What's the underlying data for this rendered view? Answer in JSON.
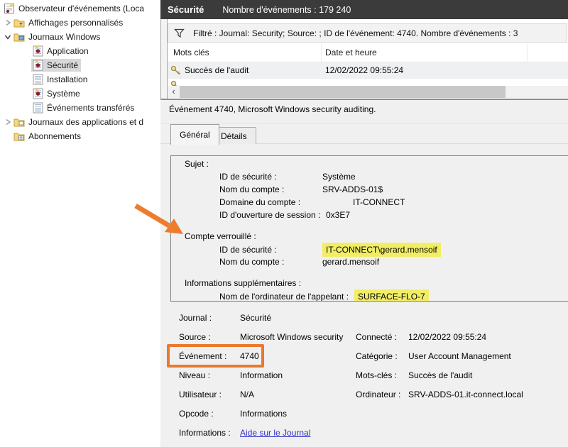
{
  "tree": {
    "items": [
      {
        "label": "Observateur d'événements (Loca",
        "level": 0,
        "icon": "event-viewer"
      },
      {
        "label": "Affichages personnalisés",
        "level": 1,
        "icon": "folder-filter",
        "expander": "collapsed"
      },
      {
        "label": "Journaux Windows",
        "level": 1,
        "icon": "folder-windows",
        "expander": "expanded"
      },
      {
        "label": "Application",
        "level": 2,
        "icon": "log-audit"
      },
      {
        "label": "Sécurité",
        "level": 2,
        "icon": "log-audit",
        "selected": true
      },
      {
        "label": "Installation",
        "level": 2,
        "icon": "log-plain"
      },
      {
        "label": "Système",
        "level": 2,
        "icon": "log-audit"
      },
      {
        "label": "Événements transférés",
        "level": 2,
        "icon": "log-plain"
      },
      {
        "label": "Journaux des applications et d",
        "level": 1,
        "icon": "folder-apps",
        "expander": "collapsed"
      },
      {
        "label": "Abonnements",
        "level": 1,
        "icon": "folder-subscriptions"
      }
    ]
  },
  "header": {
    "title": "Sécurité",
    "subtitle": "Nombre d'événements : 179 240"
  },
  "filter": {
    "text": "Filtré : Journal: Security; Source: ; ID de l'événement: 4740. Nombre d'événements : 3"
  },
  "table": {
    "columns": [
      "Mots clés",
      "Date et heure"
    ],
    "rows": [
      {
        "keyword": "Succès de l'audit",
        "datetime": "12/02/2022 09:55:24",
        "icon": "audit-key"
      }
    ]
  },
  "scrollbar": {
    "left_arrow": "‹"
  },
  "preview": {
    "title": "Événement 4740, Microsoft Windows security auditing.",
    "tabs": [
      {
        "label": "Général",
        "active": true
      },
      {
        "label": "Détails",
        "active": false
      }
    ],
    "body": {
      "sections": [
        {
          "header": "Sujet :",
          "fields": [
            {
              "label": "ID de sécurité :",
              "value": "Système"
            },
            {
              "label": "Nom du compte :",
              "value": "SRV-ADDS-01$"
            },
            {
              "label": "Domaine du compte :",
              "value": "IT-CONNECT"
            },
            {
              "label": "ID d'ouverture de session :",
              "value": "0x3E7"
            }
          ]
        },
        {
          "header": "Compte verrouillé :",
          "fields": [
            {
              "label": "ID de sécurité :",
              "value": "IT-CONNECT\\gerard.mensoif",
              "highlight": true
            },
            {
              "label": "Nom du compte :",
              "value": "gerard.mensoif"
            }
          ]
        },
        {
          "header": "Informations supplémentaires :",
          "fields": [
            {
              "label": "Nom de l'ordinateur de l'appelant :",
              "value": "SURFACE-FLO-7",
              "highlight": true
            }
          ]
        }
      ]
    },
    "properties": {
      "journal_label": "Journal :",
      "journal": "Sécurité",
      "source_label": "Source :",
      "source": "Microsoft Windows security",
      "connecte_label": "Connecté :",
      "connecte": "12/02/2022 09:55:24",
      "evenement_label": "Événement :",
      "evenement": "4740",
      "categorie_label": "Catégorie :",
      "categorie": "User Account Management",
      "niveau_label": "Niveau :",
      "niveau": "Information",
      "motscles_label": "Mots-clés :",
      "motscles": "Succès de l'audit",
      "utilisateur_label": "Utilisateur :",
      "utilisateur": "N/A",
      "ordinateur_label": "Ordinateur :",
      "ordinateur": "SRV-ADDS-01.it-connect.local",
      "opcode_label": "Opcode :",
      "opcode": "Informations",
      "informations_label": "Informations :",
      "informations_link": "Aide sur le Journal"
    }
  },
  "annotations": {
    "arrow_color": "#ed7c2f",
    "event_box_color": "#e8792e",
    "highlight_color": "#f1ee66",
    "titlebar_color": "#3b3b3b",
    "link_color": "#3333cc"
  }
}
